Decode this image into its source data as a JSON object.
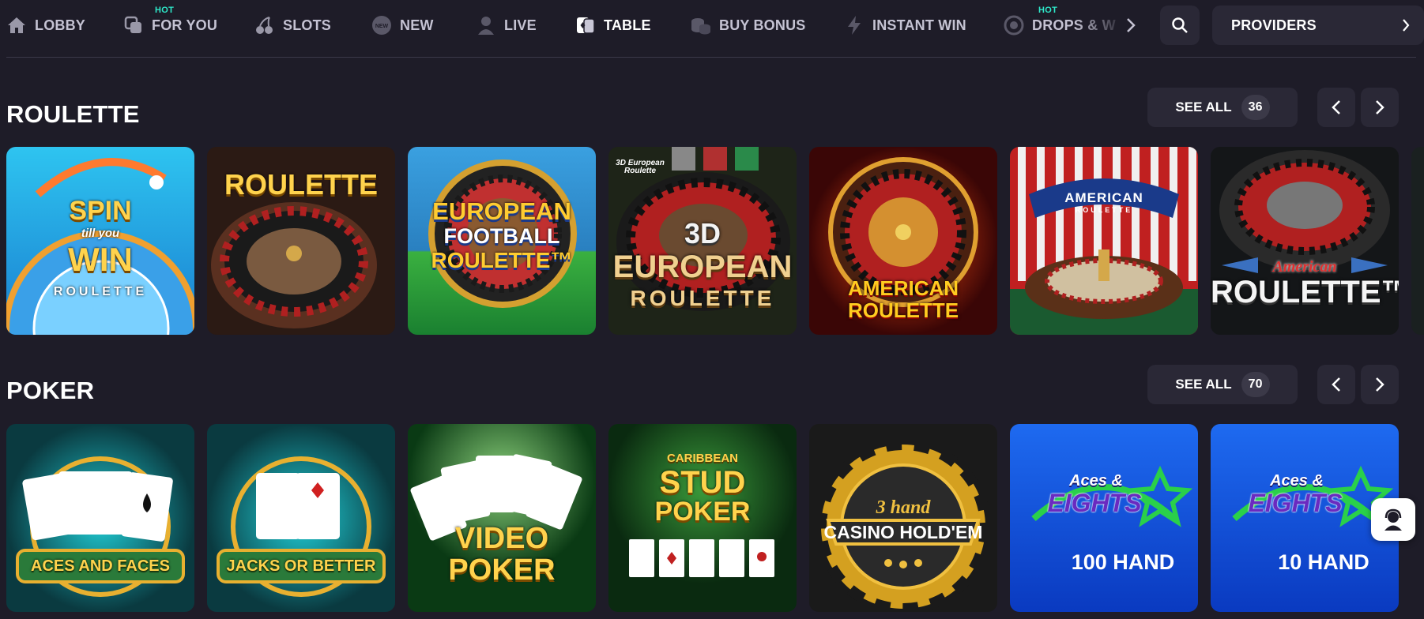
{
  "nav": {
    "items": [
      {
        "label": "LOBBY",
        "icon": "home-icon",
        "hot": ""
      },
      {
        "label": "FOR YOU",
        "icon": "for-you-icon",
        "hot": "HOT"
      },
      {
        "label": "SLOTS",
        "icon": "cherries-icon",
        "hot": ""
      },
      {
        "label": "NEW",
        "icon": "new-badge-icon",
        "hot": ""
      },
      {
        "label": "LIVE",
        "icon": "dealer-icon",
        "hot": ""
      },
      {
        "label": "TABLE",
        "icon": "cards-icon",
        "hot": ""
      },
      {
        "label": "BUY BONUS",
        "icon": "coins-icon",
        "hot": ""
      },
      {
        "label": "INSTANT WIN",
        "icon": "lightning-icon",
        "hot": ""
      },
      {
        "label": "DROPS & W",
        "icon": "drops-icon",
        "hot": "HOT"
      }
    ],
    "providers_label": "PROVIDERS"
  },
  "sections": [
    {
      "title": "ROULETTE",
      "see_all_label": "SEE ALL",
      "count": "36",
      "games": [
        {
          "name": "Spin till you Win Roulette",
          "l1": "SPIN",
          "l2": "till you",
          "l3": "WIN",
          "l4": "ROULETTE"
        },
        {
          "name": "Roulette",
          "l1": "ROULETTE"
        },
        {
          "name": "European Football Roulette",
          "l1": "EUROPEAN",
          "l2": "FOOTBALL",
          "l3": "ROULETTE™"
        },
        {
          "name": "3D European Roulette",
          "l1": "3D",
          "l2": "EUROPEAN",
          "l3": "ROULETTE",
          "tag": "3D European Roulette"
        },
        {
          "name": "American Roulette",
          "l1": "AMERICAN",
          "l2": "ROULETTE"
        },
        {
          "name": "American Roulette",
          "l1": "AMERICAN",
          "l2": "ROULETTE"
        },
        {
          "name": "American Roulette",
          "l1": "American",
          "l2": "ROULETTE™"
        }
      ]
    },
    {
      "title": "POKER",
      "see_all_label": "SEE ALL",
      "count": "70",
      "games": [
        {
          "name": "Aces and Faces",
          "l1": "ACES AND FACES"
        },
        {
          "name": "Jacks or Better",
          "l1": "JACKS OR BETTER"
        },
        {
          "name": "Video Poker",
          "l1": "VIDEO",
          "l2": "POKER"
        },
        {
          "name": "Caribbean Stud Poker",
          "l1": "CARIBBEAN",
          "l2": "STUD",
          "l3": "POKER"
        },
        {
          "name": "3 Hand Casino Hold'em",
          "l1": "3 hand",
          "l2": "CASINO HOLD'EM"
        },
        {
          "name": "Aces & Eights 100 Hand",
          "l1": "Aces &",
          "l2": "EIGHTS",
          "l3": "100 HAND"
        },
        {
          "name": "Aces & Eights 10 Hand",
          "l1": "Aces &",
          "l2": "EIGHTS",
          "l3": "10 HAND"
        }
      ]
    }
  ],
  "colors": {
    "background": "#1e1c28",
    "button": "#2a2836",
    "hot": "#2ee8c9"
  }
}
